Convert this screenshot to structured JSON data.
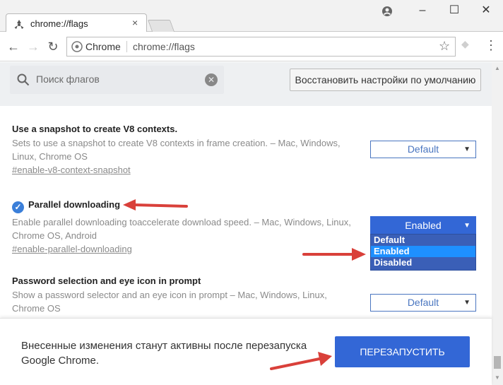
{
  "browser": {
    "tab_title": "chrome://flags",
    "tab_close": "×",
    "window_controls": {
      "minimize": "–",
      "maximize": "☐",
      "close": "✕"
    },
    "omnibox": {
      "chip": "Chrome",
      "url": "chrome://flags"
    }
  },
  "header": {
    "search_placeholder": "Поиск флагов",
    "reset_button": "Восстановить настройки по умолчанию"
  },
  "flags": [
    {
      "title": "Use a snapshot to create V8 contexts.",
      "description": "Sets to use a snapshot to create V8 contexts in frame creation. – Mac, Windows, Linux, Chrome OS",
      "link": "#enable-v8-context-snapshot",
      "value": "Default"
    },
    {
      "title": "Parallel downloading",
      "description": "Enable parallel downloading toaccelerate download speed. – Mac, Windows, Linux, Chrome OS, Android",
      "link": "#enable-parallel-downloading",
      "value": "Enabled",
      "options": [
        "Default",
        "Enabled",
        "Disabled"
      ],
      "highlighted_option": "Enabled"
    },
    {
      "title": "Password selection and eye icon in prompt",
      "description": "Show a password selector and an eye icon in prompt – Mac, Windows, Linux, Chrome OS",
      "value": "Default"
    }
  ],
  "restart": {
    "message": "Внесенные изменения станут активны после перезапуска Google Chrome.",
    "button": "ПЕРЕЗАПУСТИТЬ"
  },
  "colors": {
    "accent": "#3367d6",
    "annotation_arrow": "#d9403a",
    "dropdown_highlight": "#1e90ff"
  }
}
